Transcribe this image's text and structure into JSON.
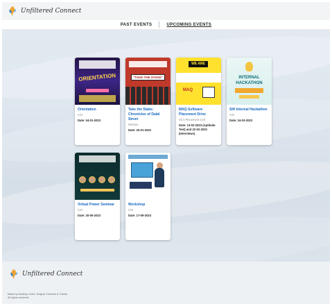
{
  "brand": {
    "name": "Unfiltered Connect"
  },
  "nav": {
    "past": "PAST EVENTS",
    "upcoming": "UPCOMING EVENTS"
  },
  "events": [
    {
      "title": "Orientation",
      "org": "CSI",
      "date": "Date: 04-01-2023",
      "poster_text": "ORIENTATION"
    },
    {
      "title": "Take the Stake: Chronicles of Dalal Street",
      "org": "Nimbus",
      "date": "Date: 20-01-2022",
      "poster_text": "\"TAKE THE STAKE\""
    },
    {
      "title": "MAQ Software Placement Drive",
      "org": "SCA Placement Cell",
      "date": "Date: 13-02-2023 (Aptitude Test) and 22-02-2023 (Interviews)",
      "poster_text": "WE ARE HIRING",
      "poster_text2": "MAQ"
    },
    {
      "title": "SIH Internal Hackathon",
      "org": "CSI",
      "date": "Date: 24-03-2023",
      "poster_text": "INTERNAL",
      "poster_text2": "HACKATHON"
    },
    {
      "title": "Virtual Power Seminar",
      "org": "CSI",
      "date": "Date: 20-06-2023"
    },
    {
      "title": "Workshop",
      "org": "CSI",
      "date": "Date: 17-09-2023"
    }
  ],
  "footer": {
    "brand": "Unfiltered Connect",
    "copyright_line1": "Made by Aradhya Joshi, Singhal Chandra & Tushar",
    "copyright_line2": "All rights reserved."
  },
  "colors": {
    "accent": "#1565c0",
    "header_bg": "#f2f4f6"
  },
  "icons": {
    "logo": "brand-logo-icon"
  }
}
